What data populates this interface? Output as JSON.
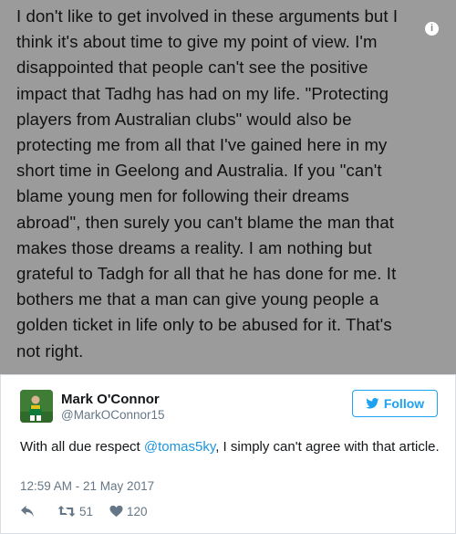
{
  "note": {
    "lines": [
      "I don't like to get involved in these arguments but I",
      "think it's about time to give my point of view. I'm",
      "disappointed that people can't see the positive",
      "impact that Tadhg has had on my life. \"Protecting",
      "players from Australian clubs\" would also be",
      "protecting me from all that I've gained here in my",
      "short time in Geelong and Australia. If you \"can't",
      "blame young men for following their dreams",
      "abroad\", then surely you can't blame the man that",
      "makes those dreams a reality. I am nothing but",
      "grateful to Tadgh for all that he has done for me. It",
      "bothers me that a man can give young people a",
      "golden ticket in life only to be abused for it. That's",
      "not right."
    ],
    "info_badge": "i"
  },
  "tweet": {
    "author_name": "Mark O'Connor",
    "author_handle": "@MarkOConnor15",
    "follow_label": "Follow",
    "text_before": "With all due respect ",
    "mention": "@tomas5ky",
    "text_after": ", I simply can't agree with that article.",
    "timestamp": "12:59 AM - 21 May 2017",
    "retweet_count": "51",
    "like_count": "120"
  },
  "colors": {
    "twitter_blue": "#1da1f2",
    "mention_blue": "#1b95e0",
    "muted": "#657786",
    "note_background": "#9b9b9b"
  },
  "icons": {
    "follow": "twitter-bird-icon",
    "reply": "reply-icon",
    "retweet": "retweet-icon",
    "like": "heart-icon",
    "info": "info-icon"
  }
}
